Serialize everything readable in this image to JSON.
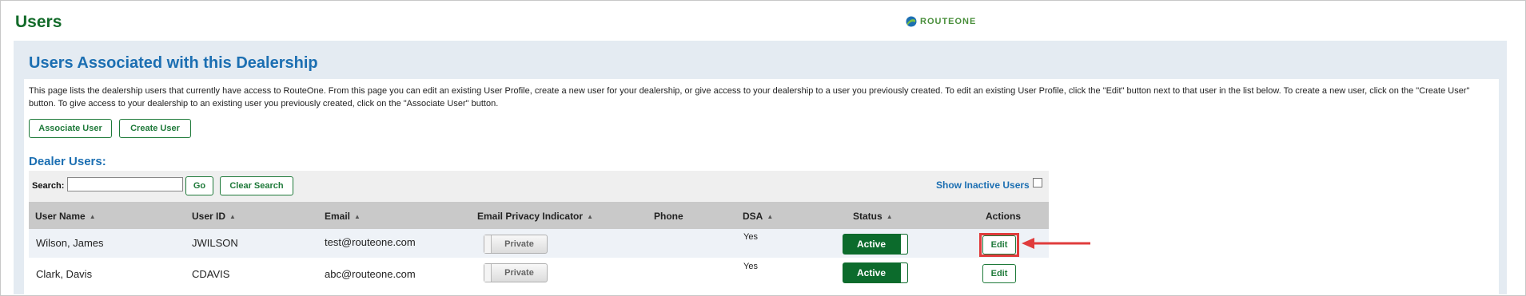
{
  "header": {
    "title": "Users",
    "logo_text": "ROUTEONE",
    "logo_colors": [
      "#1c6fb2",
      "#4a8f3c"
    ]
  },
  "main": {
    "section_title": "Users Associated with this Dealership",
    "description": "This page lists the dealership users that currently have access to RouteOne. From this page you can edit an existing User Profile, create a new user for your dealership, or give access to your dealership to a user you previously created. To edit an existing User Profile, click the \"Edit\" button next to that user in the list below. To create a new user, click on the \"Create User\" button. To give access to your dealership to an existing user you previously created, click on the \"Associate User\" button.",
    "buttons": {
      "associate_user": "Associate User",
      "create_user": "Create User"
    },
    "dealer_users_heading": "Dealer Users:"
  },
  "search": {
    "label": "Search:",
    "value": "",
    "go_label": "Go",
    "clear_label": "Clear Search",
    "show_inactive_label": "Show Inactive Users",
    "show_inactive_checked": false
  },
  "table": {
    "columns": [
      "User Name",
      "User ID",
      "Email",
      "Email Privacy Indicator",
      "Phone",
      "DSA",
      "Status",
      "Actions"
    ],
    "rows": [
      {
        "user_name": "Wilson, James",
        "user_id": "JWILSON",
        "email": "test@routeone.com",
        "privacy": "Private",
        "phone": "",
        "dsa": "Yes",
        "status": "Active",
        "action": "Edit"
      },
      {
        "user_name": "Clark, Davis",
        "user_id": "CDAVIS",
        "email": "abc@routeone.com",
        "privacy": "Private",
        "phone": "",
        "dsa": "Yes",
        "status": "Active",
        "action": "Edit"
      }
    ]
  },
  "colors": {
    "title_green": "#136b2a",
    "heading_blue": "#1c6fb2",
    "button_green": "#1f7a3a",
    "active_green": "#0c6b2c",
    "annotation_red": "#e03c3c"
  }
}
